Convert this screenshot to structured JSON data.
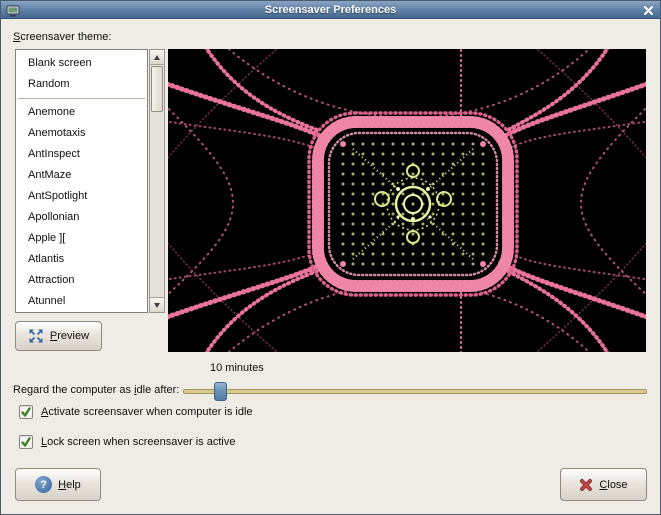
{
  "window": {
    "title": "Screensaver Preferences"
  },
  "theme_label": {
    "mnemonic": "S",
    "suffix": "creensaver theme:"
  },
  "theme_list": {
    "items": [
      "Blank screen",
      "Random",
      "Anemone",
      "Anemotaxis",
      "AntInspect",
      "AntMaze",
      "AntSpotlight",
      "Apollonian",
      "Apple ][",
      "Atlantis",
      "Attraction",
      "Atunnel"
    ]
  },
  "preview_button": {
    "mnemonic": "P",
    "suffix": "review"
  },
  "idle": {
    "prefix": "Regard the computer as ",
    "mnemonic": "i",
    "suffix": "dle after:",
    "value_label": "10 minutes"
  },
  "checkbox_activate": {
    "mnemonic": "A",
    "suffix": "ctivate screensaver when computer is idle",
    "checked": true
  },
  "checkbox_lock": {
    "mnemonic": "L",
    "suffix": "ock screen when screensaver is active",
    "checked": true
  },
  "help_button": {
    "mnemonic": "H",
    "suffix": "elp",
    "icon_char": "?"
  },
  "close_button": {
    "mnemonic": "C",
    "suffix": "lose"
  },
  "colors": {
    "titlebar_top": "#8aa5c3",
    "titlebar_bottom": "#46688f",
    "dialog_bg": "#efebe5",
    "accent_blue": "#3465a4",
    "slider_track": "#d9c98f",
    "close_icon_red": "#b2383b",
    "fractal_pink": "#ee7ba0",
    "fractal_green": "#cfdc84",
    "check_green": "#3c7e26"
  }
}
